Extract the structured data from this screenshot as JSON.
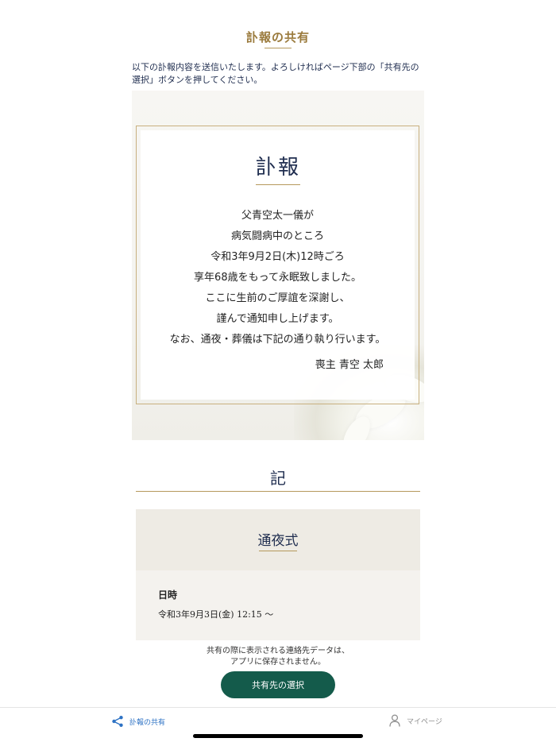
{
  "header": {
    "title": "訃報の共有",
    "intro": "以下の訃報内容を送信いたします。よろしければページ下部の「共有先の選択」ボタンを押してください。"
  },
  "notice": {
    "title": "訃報",
    "lines": [
      "父青空太一儀が",
      "病気闘病中のところ",
      "令和3年9月2日(木)12時ごろ",
      "享年68歳をもって永眠致しました。",
      "ここに生前のご厚誼を深謝し、",
      "謹んで通知申し上げます。",
      "なお、通夜・葬儀は下記の通り執り行います。"
    ],
    "mourner": "喪主 青空 太郎"
  },
  "details": {
    "heading": "記",
    "sections": [
      {
        "title": "通夜式",
        "date_label": "日時",
        "date_value": "令和3年9月3日(金) 12:15 〜"
      }
    ]
  },
  "footer": {
    "note_line1": "共有の際に表示される連絡先データは、",
    "note_line2": "アプリに保存されません。",
    "button_label": "共有先の選択"
  },
  "tabbar": {
    "share_label": "訃報の共有",
    "mypage_label": "マイページ",
    "active_color": "#2d72c4",
    "inactive_color": "#8f8f8f"
  },
  "colors": {
    "accent_gold": "#b5985c",
    "title_gold": "#9a7a3c",
    "navy": "#1f2d4f",
    "button_green": "#145b4b"
  },
  "icons": {
    "share_tab": "share-icon",
    "mypage_tab": "person-icon"
  }
}
